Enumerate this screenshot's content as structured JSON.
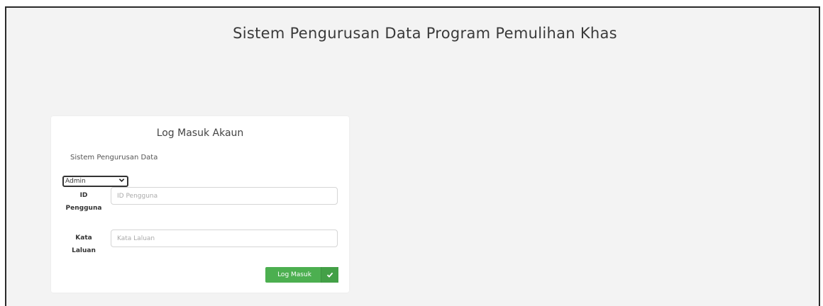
{
  "page": {
    "title": "Sistem Pengurusan Data Program Pemulihan Khas"
  },
  "login": {
    "title": "Log Masuk Akaun",
    "subtitle": "Sistem Pengurusan Data",
    "role_selected": "Admin",
    "id_label_line1": "ID",
    "id_label_line2": "Pengguna",
    "id_placeholder": "ID Pengguna",
    "id_value": "",
    "password_label_line1": "Kata",
    "password_label_line2": "Laluan",
    "password_placeholder": "Kata Laluan",
    "password_value": "",
    "submit_label": "Log Masuk",
    "submit_icon": "check-icon"
  },
  "colors": {
    "background": "#f3f3f3",
    "card": "#ffffff",
    "button": "#4caf50"
  }
}
